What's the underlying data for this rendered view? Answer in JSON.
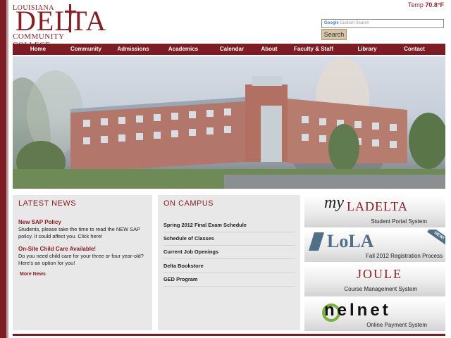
{
  "header": {
    "logo_line1": "LOUISIANA",
    "logo_line2": "DELTA",
    "logo_line3": "COMMUNITY  COLLEGE",
    "temp_label": "Temp",
    "temp_value": "70.8°F",
    "search_placeholder_brand": "Google",
    "search_placeholder": "Custom Search",
    "search_button": "Search"
  },
  "nav": [
    "Home",
    "Community",
    "Admissions",
    "Academics",
    "Calendar",
    "About",
    "Faculty & Staff",
    "Library",
    "Contact"
  ],
  "latest_news": {
    "heading": "LATEST NEWS",
    "items": [
      {
        "title": "New SAP Policy",
        "body": "Students, please take the time to read the NEW SAP policy. It could affect you. Click here!"
      },
      {
        "title": "On-Site Child Care Available!",
        "body": "Do you need child care for your three or four year-old? Here's an option for you!"
      }
    ],
    "more": "More News"
  },
  "on_campus": {
    "heading": "ON CAMPUS",
    "links": [
      "Spring 2012 Final Exam Schedule",
      "Schedule of Classes",
      "Current Job Openings",
      "Delta Bookstore",
      "GED Program"
    ]
  },
  "promos": [
    {
      "title_pre": "my",
      "title": "LADELTA",
      "subtitle": "Student Portal System"
    },
    {
      "title": "LoLA",
      "badge": "NEW!",
      "subtitle": "Fall 2012 Registration Process"
    },
    {
      "title": "JOULE",
      "subtitle": "Course Management System"
    },
    {
      "title": "nelnet",
      "subtitle": "Online Payment System"
    }
  ],
  "colors": {
    "brand": "#7d1c22",
    "accent": "#8a1d23"
  }
}
